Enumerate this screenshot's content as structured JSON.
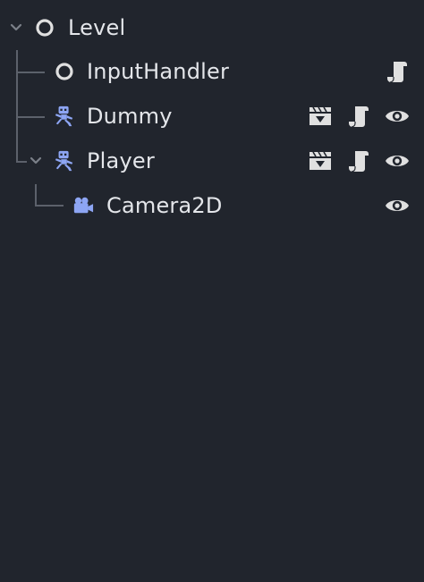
{
  "scene_tree": {
    "nodes": [
      {
        "name": "Level",
        "type_icon": "node-circle-icon",
        "expanded": true,
        "depth": 0,
        "buttons": []
      },
      {
        "name": "InputHandler",
        "type_icon": "node-circle-icon",
        "depth": 1,
        "buttons": [
          "script-icon"
        ]
      },
      {
        "name": "Dummy",
        "type_icon": "character-body-2d-icon",
        "depth": 1,
        "buttons": [
          "instanced-scene-icon",
          "script-icon",
          "visibility-eye-icon"
        ]
      },
      {
        "name": "Player",
        "type_icon": "character-body-2d-icon",
        "expanded": true,
        "depth": 1,
        "buttons": [
          "instanced-scene-icon",
          "script-icon",
          "visibility-eye-icon"
        ]
      },
      {
        "name": "Camera2D",
        "type_icon": "camera-2d-icon",
        "depth": 2,
        "buttons": [
          "visibility-eye-icon"
        ]
      }
    ]
  },
  "colors": {
    "background": "#21252d",
    "text": "#e4e6ea",
    "node_2d_blue": "#8da5f3",
    "icon_light": "#e0e0e0",
    "guide_line": "#5c616b"
  }
}
